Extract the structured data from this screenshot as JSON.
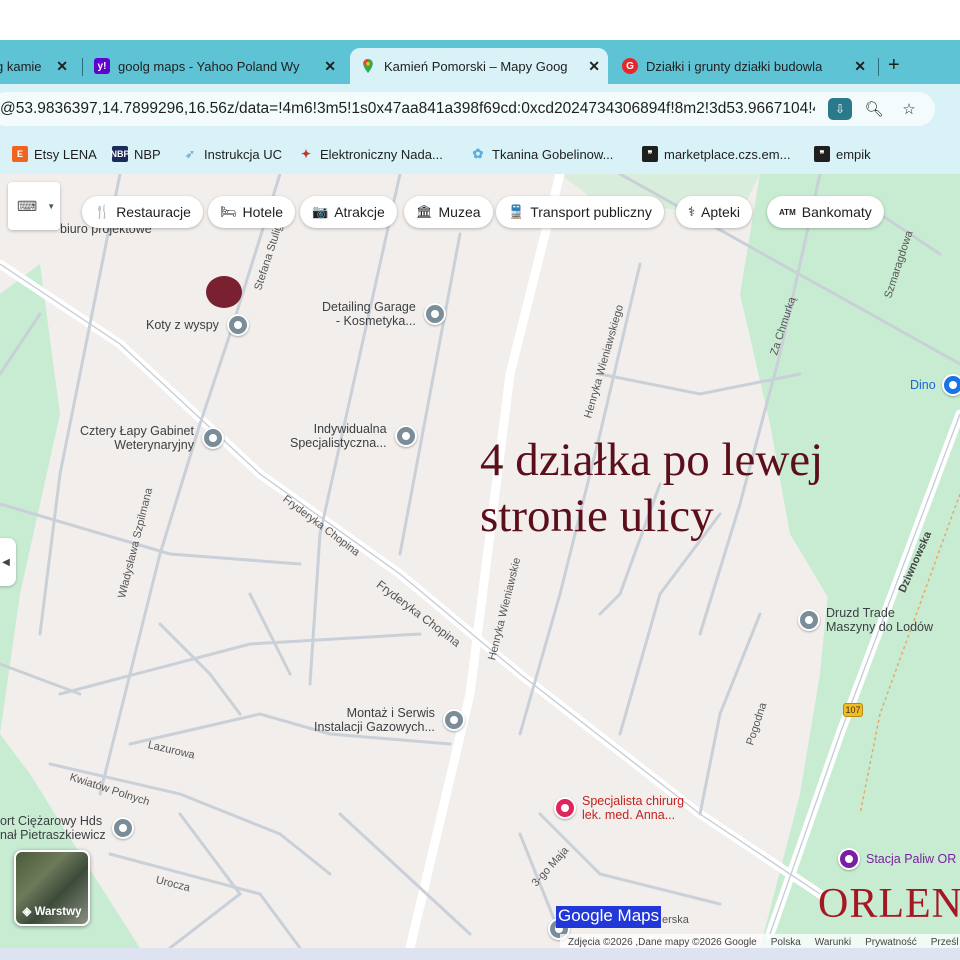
{
  "browser": {
    "tabs": [
      {
        "title": "g kamie",
        "icon": "google-icon",
        "active": false
      },
      {
        "title": "goolg maps - Yahoo Poland Wy",
        "icon": "yahoo-icon",
        "active": false
      },
      {
        "title": "Kamień Pomorski – Mapy Goog",
        "icon": "google-maps-icon",
        "active": true
      },
      {
        "title": "Działki i grunty działki budowla",
        "icon": "gratka-icon",
        "active": false
      }
    ],
    "new_tab": "+",
    "url": "@53.9836397,14.7899296,16.56z/data=!4m6!3m5!1s0x47aa841a398f69cd:0xcd2024734306894f!8m2!3d53.9667104!4d...",
    "bookmarks": [
      {
        "label": "Etsy LENA",
        "icon": "etsy-icon",
        "color": "#f1641e"
      },
      {
        "label": "NBP",
        "icon": "nbp-icon",
        "color": "#1b2b5c"
      },
      {
        "label": "Instrukcja UC",
        "icon": "bird-icon",
        "color": "#7fb3d5"
      },
      {
        "label": "Elektroniczny Nada...",
        "icon": "eagle-icon",
        "color": "#c0392b"
      },
      {
        "label": "Tkanina Gobelinow...",
        "icon": "flower-icon",
        "color": "#5dade2"
      },
      {
        "label": "marketplace.czs.em...",
        "icon": "quote-icon",
        "color": "#1f1f1f"
      },
      {
        "label": "empik",
        "icon": "quote-icon",
        "color": "#1f1f1f"
      }
    ]
  },
  "map": {
    "chips": [
      {
        "label": "Restauracje",
        "icon": "🍴"
      },
      {
        "label": "Hotele",
        "icon": "🛏"
      },
      {
        "label": "Atrakcje",
        "icon": "📷"
      },
      {
        "label": "Muzea",
        "icon": "🏛"
      },
      {
        "label": "Transport publiczny",
        "icon": "🚆"
      },
      {
        "label": "Apteki",
        "icon": "⚕"
      },
      {
        "label": "Bankomaty",
        "icon": "ATM"
      }
    ],
    "pois": [
      {
        "label": "biuro projektowe"
      },
      {
        "label": "Koty z wyspy"
      },
      {
        "label": "Detailing Garage\n- Kosmetyka..."
      },
      {
        "label": "Dino"
      },
      {
        "label": "Cztery Łapy Gabinet\nWeterynaryjny"
      },
      {
        "label": "Indywidualna\nSpecjalistyczna..."
      },
      {
        "label": "Druzd Trade\nMaszyny do Lodów"
      },
      {
        "label": "Montaż i Serwis\nInstalacji Gazowych..."
      },
      {
        "label": "Specjalista chirurg\nlek. med. Anna..."
      },
      {
        "label": "Stacja Paliw OR"
      },
      {
        "label": "ort Ciężarowy Hds\nnał Pietraszkiewicz"
      }
    ],
    "streets": [
      "Stefana Stulig",
      "Henryka Wieniawskiego",
      "Za Chmurką",
      "Szmaragdowa",
      "Władysława Szpilmana",
      "Fryderyka Chopina",
      "Fryderyka Chopina",
      "Henryka Wieniawskie",
      "Dziwnowska",
      "Pogodna",
      "Lazurowa",
      "Kwiatów Polnych",
      "3-go Maja",
      "Urocza",
      "erska"
    ],
    "route_number": "107",
    "layers_label": "Warstwy",
    "annotation_line1": "4 działka po lewej",
    "annotation_line2": "stronie ulicy",
    "brand_text": "ORLEN",
    "google_maps_label": "Google Maps",
    "attribution": {
      "imagery": "Zdjęcia ©2026 ,Dane mapy ©2026 Google",
      "country": "Polska",
      "terms": "Warunki",
      "privacy": "Prywatność",
      "feedback": "Prześl"
    }
  },
  "colors": {
    "tabstrip": "#5fc3d6",
    "toolbar": "#d9f2f7",
    "map_land": "#f1eeec",
    "map_green": "#c8ecd2",
    "annotation": "#5c0f1b",
    "orlen": "#a51723"
  }
}
